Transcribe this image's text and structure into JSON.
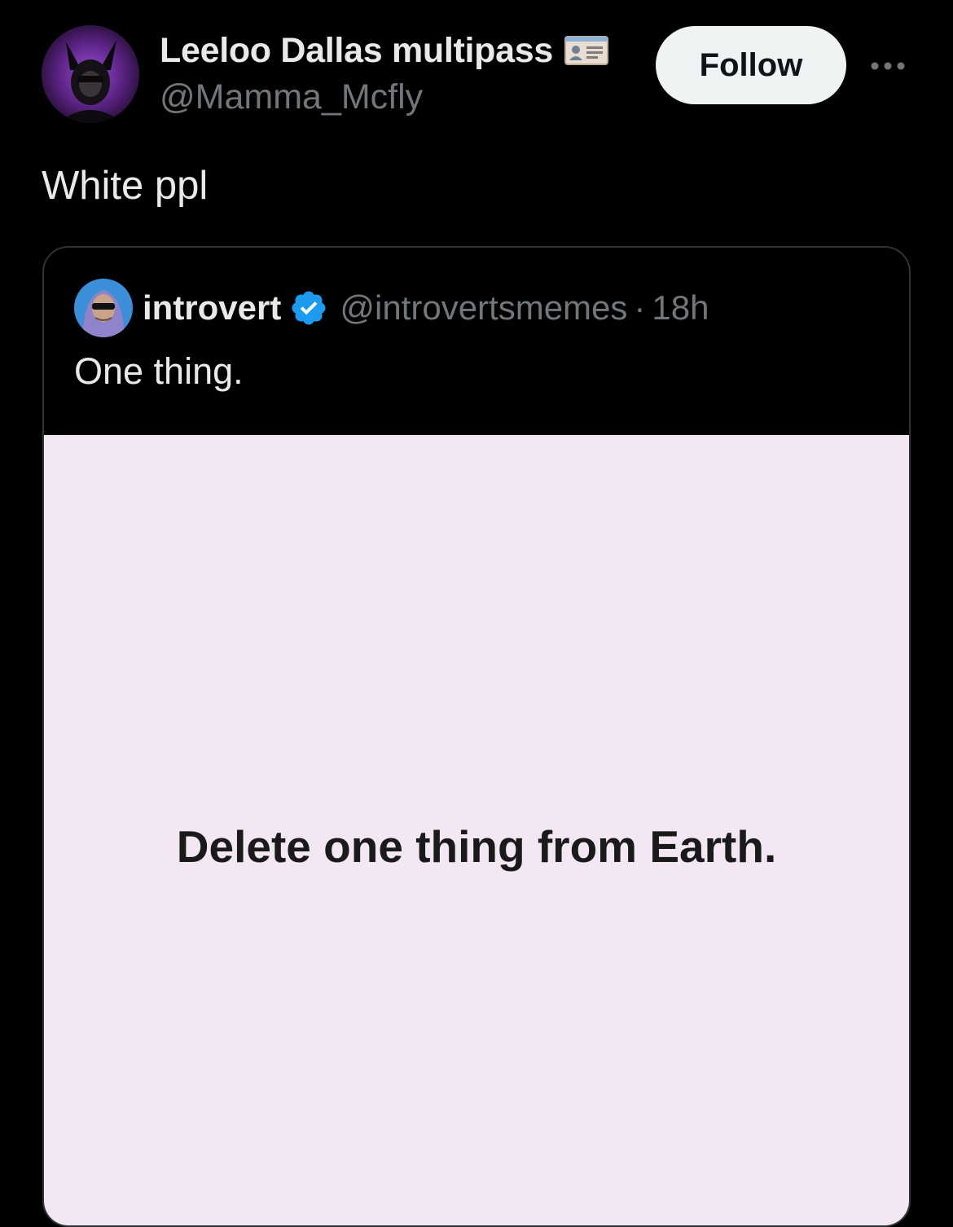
{
  "author": {
    "display_name": "Leeloo Dallas multipass",
    "handle": "@Mamma_Mcfly",
    "name_emoji_icon": "id-card-icon",
    "avatar_icon": "avatar-dark-figure-purple-glow"
  },
  "follow_button": {
    "label": "Follow"
  },
  "more_icon": "more-horizontal-icon",
  "tweet": {
    "text": "White ppl"
  },
  "quoted_tweet": {
    "display_name": "introvert",
    "verified_icon": "verified-badge-icon",
    "handle": "@introvertsmemes",
    "separator": "·",
    "time": "18h",
    "text": "One thing.",
    "image": {
      "background_color": "#f3e7f4",
      "caption": "Delete one thing from Earth."
    }
  },
  "colors": {
    "background": "#000000",
    "primary_text": "#e7e9ea",
    "secondary_text": "#71767b",
    "follow_bg": "#eff3f4",
    "follow_text": "#0f1419",
    "border": "#2f3336",
    "verified_blue": "#1d9bf0"
  }
}
